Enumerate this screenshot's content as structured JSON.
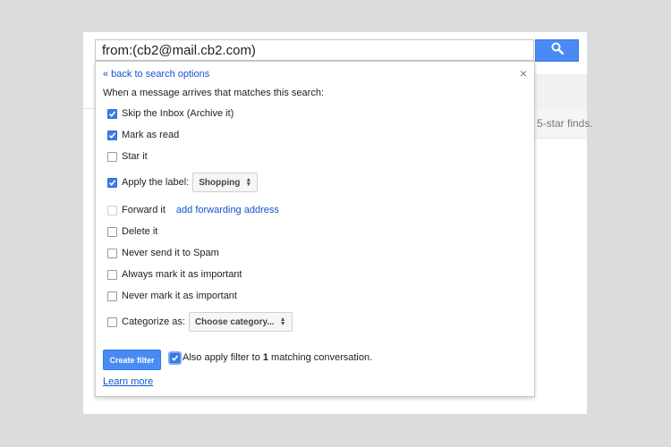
{
  "search": {
    "query": "from:(cb2@mail.cb2.com)",
    "button_icon": "search-icon",
    "button_color": "#4a8af4"
  },
  "background": {
    "teaser_text": "5-star finds."
  },
  "filter": {
    "back_link": "« back to search options",
    "close_symbol": "×",
    "intro": "When a message arrives that matches this search:",
    "options": [
      {
        "label": "Skip the Inbox (Archive it)",
        "checked": true
      },
      {
        "label": "Mark as read",
        "checked": true
      },
      {
        "label": "Star it",
        "checked": false
      },
      {
        "label": "Apply the label:",
        "checked": true,
        "select": "Shopping"
      },
      {
        "label": "Forward it",
        "checked": false,
        "disabled": true,
        "link": "add forwarding address"
      },
      {
        "label": "Delete it",
        "checked": false
      },
      {
        "label": "Never send it to Spam",
        "checked": false
      },
      {
        "label": "Always mark it as important",
        "checked": false
      },
      {
        "label": "Never mark it as important",
        "checked": false
      },
      {
        "label": "Categorize as:",
        "checked": false,
        "select": "Choose category..."
      }
    ],
    "create_button": "Create filter",
    "also_apply": {
      "prefix": "Also apply filter to ",
      "count": "1",
      "suffix": " matching conversation.",
      "checked": true
    },
    "learn_more": "Learn more"
  },
  "colors": {
    "accent": "#4a8af4",
    "link": "#1155cc",
    "checkbox_checked": "#3b7ee6"
  }
}
